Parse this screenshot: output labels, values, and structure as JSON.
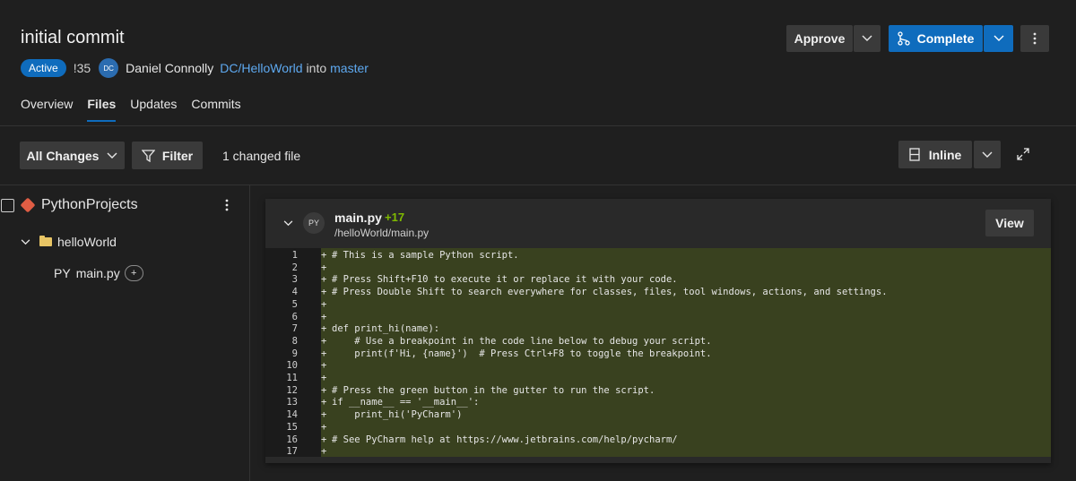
{
  "pr": {
    "title": "initial commit",
    "status": "Active",
    "id": "!35",
    "author_initials": "DC",
    "author": "Daniel Connolly",
    "source_repo": "DC/HelloWorld",
    "into_word": "into",
    "target_branch": "master"
  },
  "tabs": [
    "Overview",
    "Files",
    "Updates",
    "Commits"
  ],
  "actions": {
    "approve": "Approve",
    "complete": "Complete"
  },
  "toolbar": {
    "changes_filter": "All Changes",
    "filter": "Filter",
    "changed_count": "1 changed file",
    "view_mode": "Inline"
  },
  "tree": {
    "root": "PythonProjects",
    "folder": "helloWorld",
    "file_type": "PY",
    "file": "main.py",
    "badge": "+"
  },
  "diff": {
    "file_type": "PY",
    "file_name": "main.py",
    "added": "+17",
    "path": "/helloWorld/main.py",
    "view_label": "View",
    "marker": "+",
    "lines": [
      {
        "n": "1",
        "text": "# This is a sample Python script."
      },
      {
        "n": "2",
        "text": ""
      },
      {
        "n": "3",
        "text": "# Press Shift+F10 to execute it or replace it with your code."
      },
      {
        "n": "4",
        "text": "# Press Double Shift to search everywhere for classes, files, tool windows, actions, and settings."
      },
      {
        "n": "5",
        "text": ""
      },
      {
        "n": "6",
        "text": ""
      },
      {
        "n": "7",
        "text": "def print_hi(name):"
      },
      {
        "n": "8",
        "text": "    # Use a breakpoint in the code line below to debug your script."
      },
      {
        "n": "9",
        "text": "    print(f'Hi, {name}')  # Press Ctrl+F8 to toggle the breakpoint."
      },
      {
        "n": "10",
        "text": ""
      },
      {
        "n": "11",
        "text": ""
      },
      {
        "n": "12",
        "text": "# Press the green button in the gutter to run the script."
      },
      {
        "n": "13",
        "text": "if __name__ == '__main__':"
      },
      {
        "n": "14",
        "text": "    print_hi('PyCharm')"
      },
      {
        "n": "15",
        "text": ""
      },
      {
        "n": "16",
        "text": "# See PyCharm help at https://www.jetbrains.com/help/pycharm/"
      },
      {
        "n": "17",
        "text": ""
      }
    ]
  },
  "icons": {
    "chevron": "chevron-down-icon",
    "more": "more-vertical-icon",
    "branch": "branch-icon",
    "filter": "filter-icon",
    "inline": "inline-view-icon",
    "expand": "expand-icon",
    "repo": "git-repo-icon",
    "folder": "folder-icon"
  },
  "colors": {
    "accent": "#0f6cbd",
    "link": "#5ea9f0",
    "added_text": "#7fba00",
    "added_bg": "#39411f"
  }
}
